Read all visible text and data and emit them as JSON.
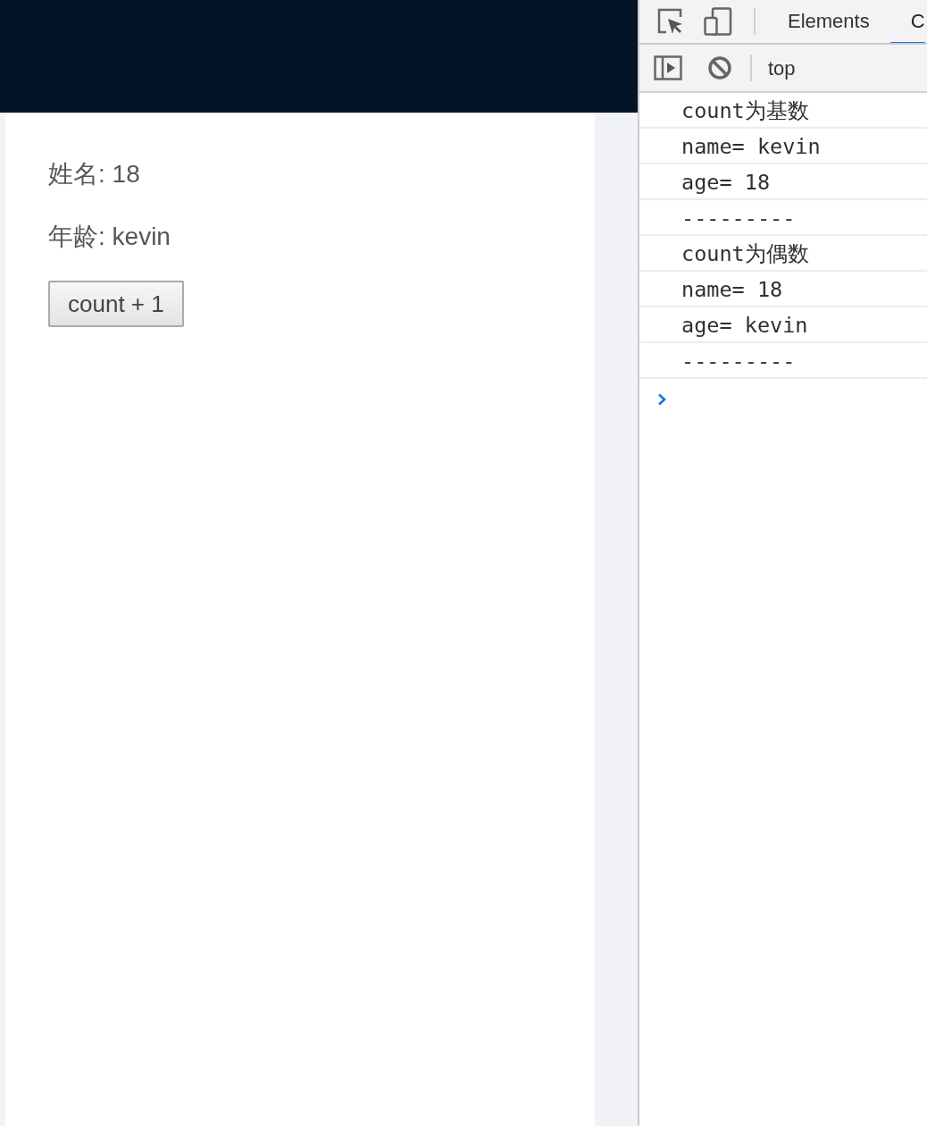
{
  "page": {
    "lines": [
      "姓名: 18",
      "年龄: kevin"
    ],
    "button": "count + 1"
  },
  "devtools": {
    "tabs": [
      {
        "label": "Elements",
        "selected": false
      },
      {
        "label": "C",
        "selected": true
      }
    ],
    "context": "top",
    "console": {
      "messages": [
        "count为基数",
        "name= kevin",
        "age= 18",
        "---------",
        "count为偶数",
        "name= 18",
        "age= kevin",
        "---------"
      ]
    }
  }
}
